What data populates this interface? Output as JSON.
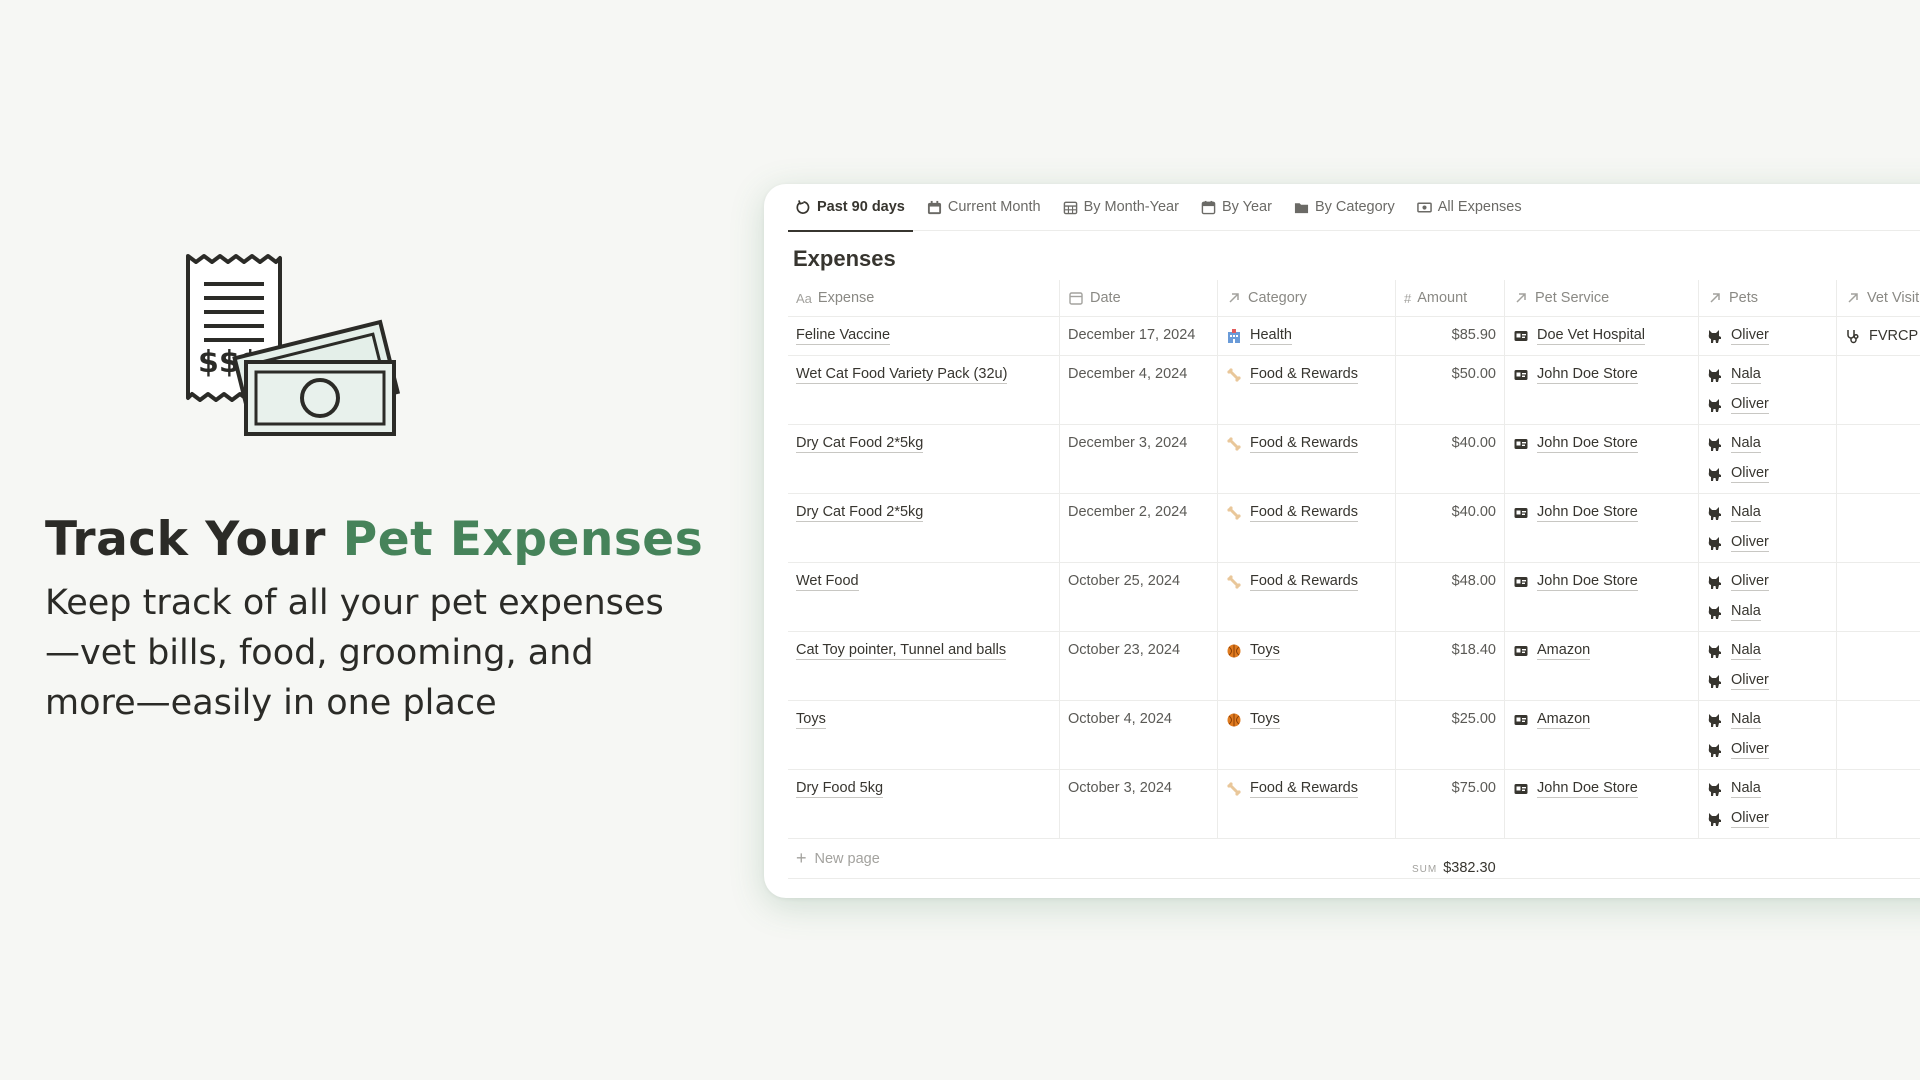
{
  "hero": {
    "title_main": "Track Your ",
    "title_accent": "Pet Expenses",
    "subtitle": "Keep track of all your pet expenses—vet bills, food, grooming, and more—easily in one place",
    "icon": "receipt-money-icon"
  },
  "tabs": [
    {
      "label": "Past 90 days",
      "icon": "refresh-icon",
      "active": true
    },
    {
      "label": "Current Month",
      "icon": "calendar-icon",
      "active": false
    },
    {
      "label": "By Month-Year",
      "icon": "table-icon",
      "active": false
    },
    {
      "label": "By Year",
      "icon": "calendar-icon",
      "active": false
    },
    {
      "label": "By Category",
      "icon": "folder-icon",
      "active": false
    },
    {
      "label": "All Expenses",
      "icon": "money-icon",
      "active": false
    }
  ],
  "database": {
    "title": "Expenses",
    "columns": {
      "expense": {
        "prefix": "Aa",
        "label": "Expense"
      },
      "date": {
        "label": "Date"
      },
      "category": {
        "label": "Category"
      },
      "amount": {
        "prefix": "#",
        "label": "Amount"
      },
      "pet_service": {
        "label": "Pet Service"
      },
      "pets": {
        "label": "Pets"
      },
      "vet_visit": {
        "label": "Vet Visit"
      }
    },
    "rows": [
      {
        "expense": "Feline Vaccine",
        "date": "December 17, 2024",
        "category": "Health",
        "amount": "$85.90",
        "service": "Doe Vet Hospital",
        "pets": [
          "Oliver"
        ],
        "vet": "FVRCP V"
      },
      {
        "expense": "Wet Cat Food Variety Pack (32u)",
        "date": "December 4, 2024",
        "category": "Food & Rewards",
        "amount": "$50.00",
        "service": "John Doe Store",
        "pets": [
          "Nala",
          "Oliver"
        ],
        "vet": ""
      },
      {
        "expense": "Dry Cat Food 2*5kg",
        "date": "December 3, 2024",
        "category": "Food & Rewards",
        "amount": "$40.00",
        "service": "John Doe Store",
        "pets": [
          "Nala",
          "Oliver"
        ],
        "vet": ""
      },
      {
        "expense": "Dry Cat Food 2*5kg",
        "date": "December 2, 2024",
        "category": "Food & Rewards",
        "amount": "$40.00",
        "service": "John Doe Store",
        "pets": [
          "Nala",
          "Oliver"
        ],
        "vet": ""
      },
      {
        "expense": "Wet Food",
        "date": "October 25, 2024",
        "category": "Food & Rewards",
        "amount": "$48.00",
        "service": "John Doe Store",
        "pets": [
          "Oliver",
          "Nala"
        ],
        "vet": ""
      },
      {
        "expense": "Cat Toy pointer, Tunnel and balls",
        "date": "October 23, 2024",
        "category": "Toys",
        "amount": "$18.40",
        "service": "Amazon",
        "pets": [
          "Nala",
          "Oliver"
        ],
        "vet": ""
      },
      {
        "expense": "Toys",
        "date": "October 4, 2024",
        "category": "Toys",
        "amount": "$25.00",
        "service": "Amazon",
        "pets": [
          "Nala",
          "Oliver"
        ],
        "vet": ""
      },
      {
        "expense": "Dry Food 5kg",
        "date": "October 3, 2024",
        "category": "Food & Rewards",
        "amount": "$75.00",
        "service": "John Doe Store",
        "pets": [
          "Nala",
          "Oliver"
        ],
        "vet": ""
      }
    ],
    "category_icons": {
      "Health": "hospital-icon",
      "Food & Rewards": "bone-icon",
      "Toys": "ball-icon"
    },
    "new_page_label": "New page",
    "sum_label": "SUM",
    "sum_value": "$382.30"
  },
  "colors": {
    "background": "#f6f7f4",
    "accent_green": "#46835a",
    "text_dark": "#2b2b27"
  }
}
